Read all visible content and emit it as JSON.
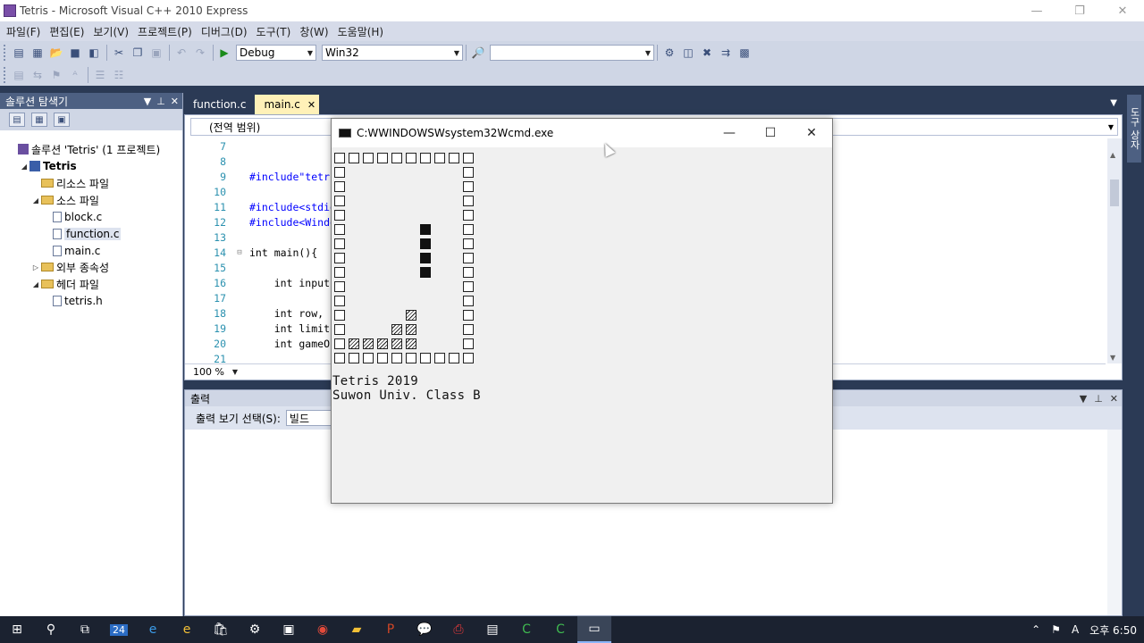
{
  "window": {
    "title": "Tetris - Microsoft Visual C++ 2010 Express",
    "minimize": "—",
    "restore": "❐",
    "close": "✕"
  },
  "menu": [
    "파일(F)",
    "편집(E)",
    "보기(V)",
    "프로젝트(P)",
    "디버그(D)",
    "도구(T)",
    "창(W)",
    "도움말(H)"
  ],
  "toolbar": {
    "config": "Debug",
    "platform": "Win32",
    "find_value": ""
  },
  "solution_explorer": {
    "title": "솔루션 탐색기",
    "items": [
      {
        "label": "솔루션 'Tetris' (1 프로젝트)",
        "kind": "solution",
        "indent": 0,
        "expander": ""
      },
      {
        "label": "Tetris",
        "kind": "project",
        "indent": 1,
        "expander": "◢",
        "bold": true
      },
      {
        "label": "리소스 파일",
        "kind": "folder",
        "indent": 2,
        "expander": ""
      },
      {
        "label": "소스 파일",
        "kind": "folder",
        "indent": 2,
        "expander": "◢"
      },
      {
        "label": "block.c",
        "kind": "file",
        "indent": 3,
        "expander": ""
      },
      {
        "label": "function.c",
        "kind": "file",
        "indent": 3,
        "expander": "",
        "selected": true
      },
      {
        "label": "main.c",
        "kind": "file",
        "indent": 3,
        "expander": ""
      },
      {
        "label": "외부 종속성",
        "kind": "folder",
        "indent": 2,
        "expander": "▷"
      },
      {
        "label": "헤더 파일",
        "kind": "folder",
        "indent": 2,
        "expander": "◢"
      },
      {
        "label": "tetris.h",
        "kind": "file",
        "indent": 3,
        "expander": ""
      }
    ]
  },
  "tabs": [
    {
      "label": "function.c",
      "active": false
    },
    {
      "label": "main.c",
      "active": true
    }
  ],
  "editor": {
    "scope": "(전역 범위)",
    "zoom": "100 %",
    "lines": [
      {
        "n": "7",
        "code": ""
      },
      {
        "n": "8",
        "code": ""
      },
      {
        "n": "9",
        "code": "#include\"tetr"
      },
      {
        "n": "10",
        "code": ""
      },
      {
        "n": "11",
        "code": "#include<stdio"
      },
      {
        "n": "12",
        "code": "#include<Windo"
      },
      {
        "n": "13",
        "code": ""
      },
      {
        "n": "14",
        "code": "int main(){"
      },
      {
        "n": "15",
        "code": ""
      },
      {
        "n": "16",
        "code": "    int input"
      },
      {
        "n": "17",
        "code": ""
      },
      {
        "n": "18",
        "code": "    int row, c"
      },
      {
        "n": "19",
        "code": "    int limit"
      },
      {
        "n": "20",
        "code": "    int gameO"
      },
      {
        "n": "21",
        "code": ""
      }
    ]
  },
  "output": {
    "title": "출력",
    "select_label": "출력 보기 선택(S):",
    "select_value": "빌드"
  },
  "right_tab": "도구 상자",
  "console": {
    "title": "C:WWINDOWSWsystem32Wcmd.exe",
    "line1": "Tetris 2019",
    "line2": "Suwon Univ. Class B",
    "minimize": "—",
    "maximize": "☐",
    "close": "✕"
  },
  "taskbar": {
    "calendar_badge": "24",
    "ime": "A",
    "time": "오후 6:50"
  }
}
